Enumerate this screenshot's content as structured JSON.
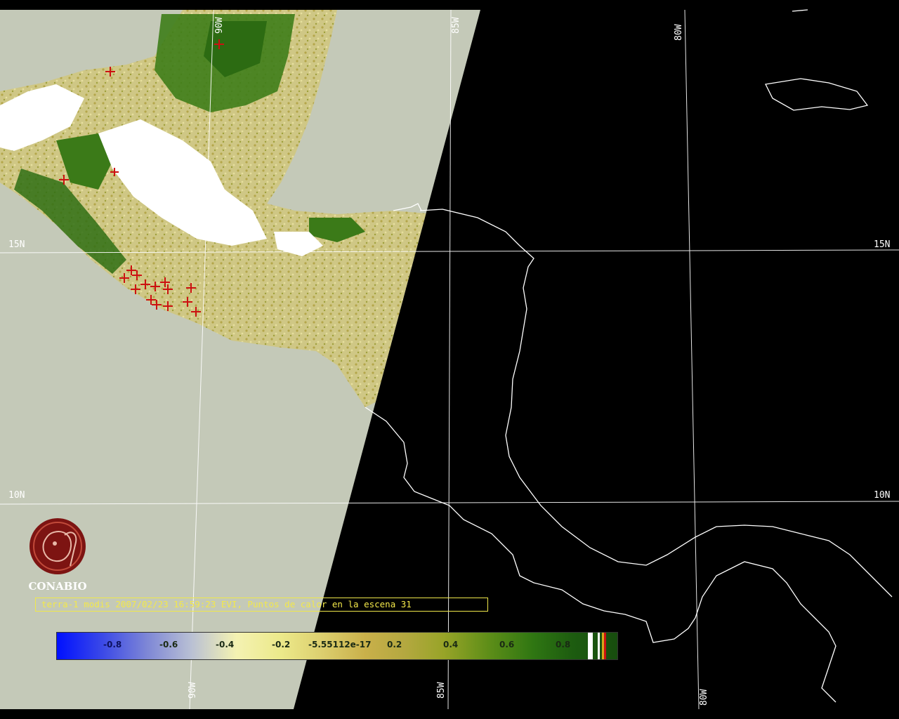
{
  "grid_labels": {
    "lat_15n_left": "15N",
    "lat_15n_right": "15N",
    "lat_10n_left": "10N",
    "lat_10n_right": "10N",
    "lon_90w_top": "90W",
    "lon_85w_top": "85W",
    "lon_80w_top": "80W",
    "lon_90w_bottom": "90W",
    "lon_85w_bottom": "85W",
    "lon_80w_bottom": "80W"
  },
  "logo": {
    "name": "CONABIO"
  },
  "caption": "terra-1 modis 2007/02/23 16:59:23 EVI, Puntos de calor en la escena 31",
  "colorbar": {
    "ticks": [
      "-0.8",
      "-0.6",
      "-0.4",
      "-0.2",
      "-5.55112e-17",
      "0.2",
      "0.4",
      "0.6",
      "0.8"
    ],
    "tick_values": [
      -0.8,
      -0.6,
      -0.4,
      -0.2,
      -5.55112e-17,
      0.2,
      0.4,
      0.6,
      0.8
    ],
    "range": [
      -1.0,
      1.0
    ]
  },
  "colors": {
    "background": "#000000",
    "no_data": "#c4c9b8",
    "coastline": "#ffffff",
    "hotspot": "#cc1111",
    "caption": "#f3e84a"
  }
}
